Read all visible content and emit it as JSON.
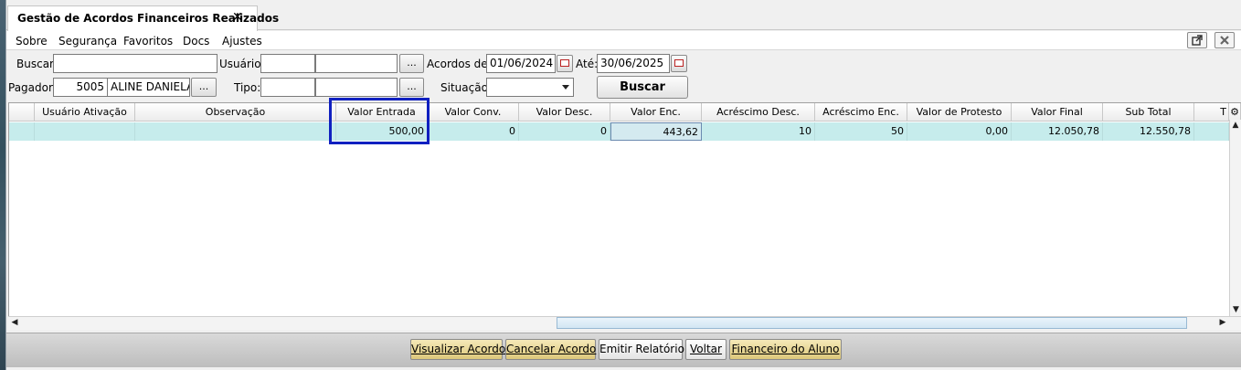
{
  "tab": {
    "title": "Gestão de Acordos Financeiros Realizados",
    "close": "✕"
  },
  "menu": {
    "items": [
      "Sobre",
      "Segurança",
      "Favoritos",
      "Docs",
      "Ajustes"
    ]
  },
  "window_buttons": {
    "popout_icon": "popout-icon",
    "close_icon": "close-icon"
  },
  "filters": {
    "buscar_label": "Buscar:",
    "buscar_value": "",
    "usuario_label": "Usuário:",
    "usuario_code": "",
    "usuario_name": "",
    "usuario_lookup": "...",
    "acordos_label": "Acordos de:",
    "acordos_from": "01/06/2024",
    "ate_label": "Até:",
    "acordos_to": "30/06/2025",
    "pagador_label": "Pagador:",
    "pagador_code": "5005",
    "pagador_name": "ALINE DANIELA",
    "pagador_lookup": "...",
    "tipo_label": "Tipo:",
    "tipo_code": "",
    "tipo_name": "",
    "tipo_lookup": "...",
    "situacao_label": "Situação:",
    "situacao_value": "",
    "buscar_button": "Buscar"
  },
  "grid": {
    "columns": [
      "Usuário Ativação",
      "Observação",
      "Valor Entrada",
      "Valor Conv.",
      "Valor Desc.",
      "Valor Enc.",
      "Acréscimo Desc.",
      "Acréscimo Enc.",
      "Valor de Protesto",
      "Valor Final",
      "Sub Total",
      "T"
    ],
    "rows": [
      [
        "",
        "",
        "500,00",
        "0",
        "0",
        "443,62",
        "10",
        "50",
        "0,00",
        "12.050,78",
        "12.550,78",
        ""
      ]
    ],
    "settings_icon": "gear-icon"
  },
  "actions": {
    "visualizar": "Visualizar Acordo",
    "cancelar": "Cancelar Acordo",
    "emitir": "Emitir Relatório",
    "voltar": "Voltar",
    "financeiro": "Financeiro do Aluno"
  }
}
